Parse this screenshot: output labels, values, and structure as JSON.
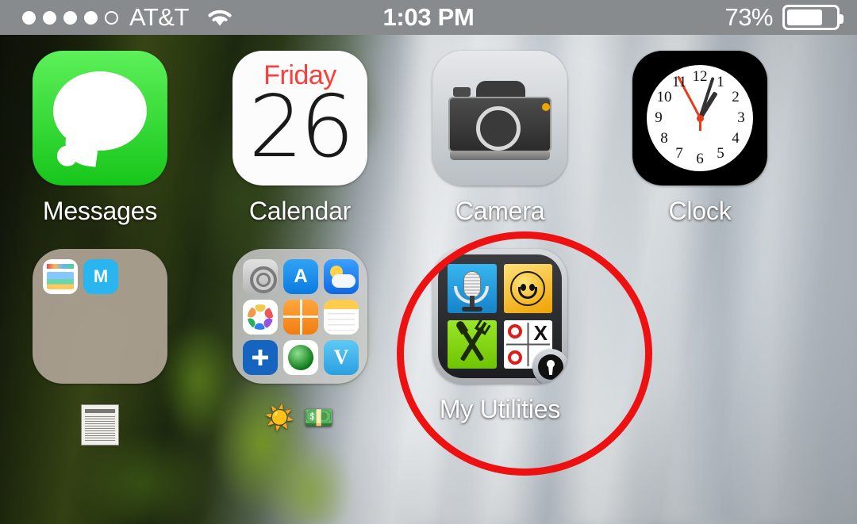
{
  "status_bar": {
    "signal_dots_total": 5,
    "signal_dots_filled": 4,
    "carrier": "AT&T",
    "wifi_icon": "wifi-icon",
    "time": "1:03 PM",
    "battery_percent": "73%",
    "battery_level": 73
  },
  "home_screen": {
    "wallpaper": "waterfall-photo",
    "rows": [
      {
        "apps": [
          {
            "name": "Messages",
            "label": "Messages",
            "icon": "messages-icon",
            "color": "#35d34a"
          },
          {
            "name": "Calendar",
            "label": "Calendar",
            "icon": "calendar-icon",
            "weekday": "Friday",
            "date": "26",
            "weekday_color": "#fc3d39"
          },
          {
            "name": "Camera",
            "label": "Camera",
            "icon": "camera-icon",
            "color": "#cfd3d7"
          },
          {
            "name": "Clock",
            "label": "Clock",
            "icon": "clock-icon",
            "color": "#000000",
            "numerals": [
              "12",
              "1",
              "2",
              "3",
              "4",
              "5",
              "6",
              "7",
              "8",
              "9",
              "10",
              "11"
            ]
          }
        ]
      },
      {
        "apps": [
          {
            "name": "folder-tan",
            "label": "",
            "icon": "folder-icon",
            "color": "#b0a496",
            "sublabel_icon": "newspaper-icon",
            "mini_apps": [
              "news-icon",
              "m-icon"
            ]
          },
          {
            "name": "folder-gray",
            "label": "☀️ 💵",
            "icon": "folder-icon",
            "color": "#cecece",
            "mini_apps": [
              "settings-icon",
              "app-store-icon",
              "weather-icon",
              "photos-icon",
              "calculator-icon",
              "notes-icon",
              "chase-icon",
              "find-friends-icon",
              "venmo-icon"
            ]
          },
          {
            "name": "My Utilities",
            "label": "My Utilities",
            "icon": "my-utilities-icon",
            "tiles": [
              "microphone-tile",
              "smiley-tile",
              "fork-knife-tile",
              "tic-tac-toe-tile"
            ],
            "badge": "lock-badge-icon"
          },
          {
            "name": "empty-slot",
            "label": "",
            "icon": ""
          }
        ]
      }
    ]
  },
  "annotation": {
    "shape": "ellipse",
    "color": "#ee1111",
    "targets": "My Utilities",
    "stroke_width": 9
  }
}
